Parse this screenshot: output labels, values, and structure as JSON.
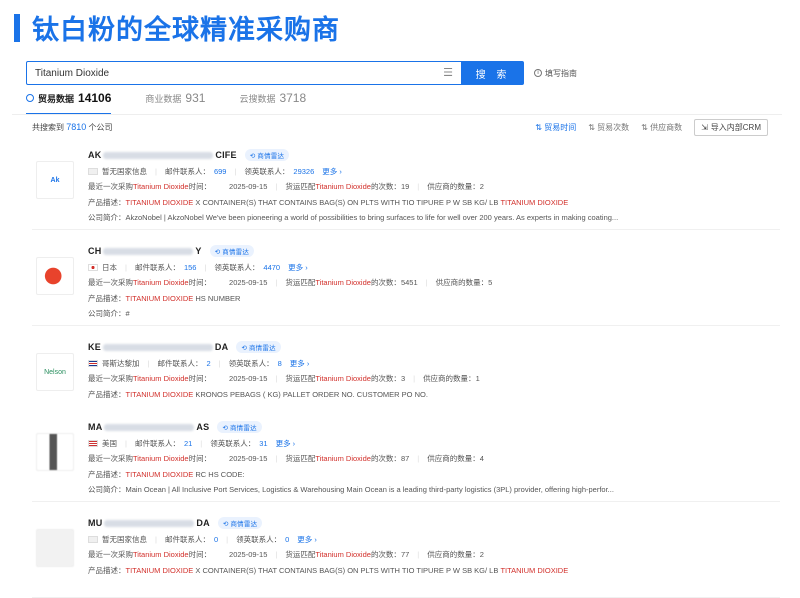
{
  "banner_title": "钛白粉的全球精准采购商",
  "search": {
    "value": "Titanium Dioxide",
    "button": "搜 索",
    "guide": "填写指南"
  },
  "tabs": [
    {
      "label": "贸易数据",
      "count": "14106"
    },
    {
      "label": "商业数据",
      "count": "931"
    },
    {
      "label": "云搜数据",
      "count": "3718"
    }
  ],
  "result": {
    "prefix": "共搜索到",
    "count": "7810",
    "suffix": "个公司"
  },
  "sorts": [
    "贸易时间",
    "贸易次数",
    "供应商数"
  ],
  "crm_button": "导入内部CRM",
  "labels": {
    "radar": "商情雷达",
    "email": "邮件联系人：",
    "linkedin": "领英联系人：",
    "more": "更多",
    "recent": "最近一次采购",
    "time": "时间：",
    "match_prefix": "货运匹配",
    "match_suffix": "的次数：",
    "suppliers": "供应商的数量：",
    "product": "产品描述：",
    "intro": "公司简介："
  },
  "companies": [
    {
      "name_start": "AK",
      "name_end": "CIFE",
      "logo": "Ak",
      "country": "暂无国家信息",
      "email_count": "699",
      "linkedin_count": "29326",
      "keyword": "Titanium Dioxide",
      "date": "2025-09-15",
      "match_count": "19",
      "supplier_count": "2",
      "product_red_1": "TITANIUM DIOXIDE",
      "product_rest": "X CONTAINER(S) THAT CONTAINS BAG(S) ON PLTS WITH TIO TIPURE P W SB KG/ LB",
      "product_red_2": "TITANIUM DIOXIDE",
      "intro": "AkzoNobel | AkzoNobel We've been pioneering a world of possibilities to bring surfaces to life for well over 200 years. As experts in making coating..."
    },
    {
      "name_start": "CH",
      "name_end": "Y",
      "logo": "",
      "country": "日本",
      "email_count": "156",
      "linkedin_count": "4470",
      "keyword": "Titanium Dioxide",
      "date": "2025-09-15",
      "match_count": "5451",
      "supplier_count": "5",
      "product_red_1": "TITANIUM DIOXIDE",
      "product_rest": "HS NUMBER",
      "product_red_2": "",
      "intro": "#"
    },
    {
      "name_start": "KE",
      "name_end": "DA",
      "logo": "Nelson",
      "country": "哥斯达黎加",
      "email_count": "2",
      "linkedin_count": "8",
      "keyword": "Titanium Dioxide",
      "date": "2025-09-15",
      "match_count": "3",
      "supplier_count": "1",
      "product_red_1": "TITANIUM DIOXIDE",
      "product_rest": "KRONOS PEBAGS ( KG) PALLET ORDER NO. CUSTOMER PO NO.",
      "product_red_2": "",
      "intro": ""
    },
    {
      "name_start": "MA",
      "name_end": "AS",
      "logo": "",
      "country": "美国",
      "email_count": "21",
      "linkedin_count": "31",
      "keyword": "Titanium Dioxide",
      "date": "2025-09-15",
      "match_count": "87",
      "supplier_count": "4",
      "product_red_1": "TITANIUM DIOXIDE",
      "product_rest": "RC HS CODE:",
      "product_red_2": "",
      "intro": "Main Ocean | All Inclusive Port Services, Logistics & Warehousing Main Ocean is a leading third-party logistics (3PL) provider, offering high-perfor..."
    },
    {
      "name_start": "MU",
      "name_end": "DA",
      "logo": "",
      "country": "暂无国家信息",
      "email_count": "0",
      "linkedin_count": "0",
      "keyword": "Titanium Dioxide",
      "date": "2025-09-15",
      "match_count": "77",
      "supplier_count": "2",
      "product_red_1": "TITANIUM DIOXIDE",
      "product_rest": "X CONTAINER(S) THAT CONTAINS BAG(S) ON PLTS WITH TIO TIPURE P W SB KG/ LB",
      "product_red_2": "TITANIUM DIOXIDE",
      "intro": ""
    }
  ],
  "colors": {
    "accent": "#1a73e8",
    "highlight": "#d2302b"
  }
}
